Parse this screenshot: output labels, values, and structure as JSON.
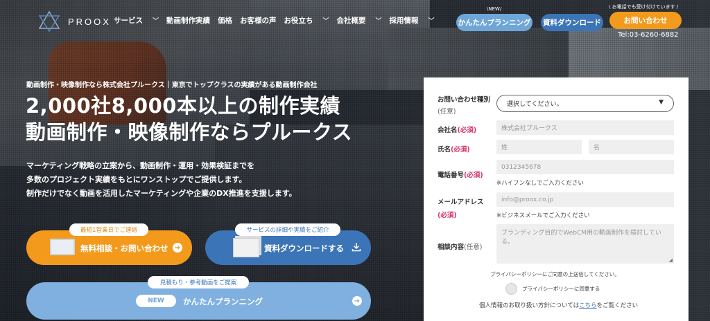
{
  "header": {
    "logo_text": "PROOX",
    "nav": [
      {
        "label": "サービス",
        "dropdown": true
      },
      {
        "label": "動画制作実績",
        "dropdown": false
      },
      {
        "label": "価格",
        "dropdown": false
      },
      {
        "label": "お客様の声",
        "dropdown": false
      },
      {
        "label": "お役立ち",
        "dropdown": true
      },
      {
        "label": "会社概要",
        "dropdown": true
      },
      {
        "label": "採用情報",
        "dropdown": true
      }
    ],
    "planning_note": "\\NEW/",
    "planning_button": "かんたんプランニング",
    "download_button": "資料ダウンロード",
    "contact_note": "\\ お電話でも受け付けています /",
    "contact_button": "お問い合わせ",
    "tel": "Tel:03-6260-6882"
  },
  "hero": {
    "subtitle": "動画制作・映像制作なら株式会社プルークス｜東京でトップクラスの実績がある動画制作会社",
    "title_line1": "2,000社8,000本以上の制作実績",
    "title_line2": "動画制作・映像制作ならプルークス",
    "desc_line1": "マーケティング戦略の立案から、動画制作・運用・効果検証までを",
    "desc_line2": "多数のプロジェクト実績をもとにワンストップでご提供します。",
    "desc_line3": "制作だけでなく動画を活用したマーケティングや企業のDX推進を支援します。"
  },
  "cta": {
    "free_tag": "最短1営業日でご連絡",
    "free_label": "無料相談・お問い合わせ",
    "dl_tag": "サービスの詳細や実績をご紹介",
    "dl_label": "資料ダウンロードする",
    "plan_tag": "見積もり・参考動画をご提案",
    "plan_new": "NEW",
    "plan_label": "かんたんプランニング"
  },
  "form": {
    "type_label": "お問い合わせ種別",
    "type_optional": "(任意)",
    "type_select": "選択してください。",
    "company_label": "会社名",
    "required": "(必須)",
    "company_placeholder": "株式会社プルークス",
    "name_label": "氏名",
    "last_name_placeholder": "姓",
    "first_name_placeholder": "名",
    "phone_label": "電話番号",
    "phone_placeholder": "0312345678",
    "phone_hint": "※ハイフンなしでご入力ください",
    "email_label": "メールアドレス",
    "email_placeholder": "info@proox.co.jp",
    "email_hint": "※ビジネスメールでご入力ください",
    "content_label": "相談内容",
    "content_optional": "(任意)",
    "content_placeholder": "ブランディング目的でWebCM用の動画制作を検討している。",
    "policy_note": "プライバシーポリシーにご同意の上送信してください。",
    "agree_label": "プライバシーポリシーに同意する",
    "privacy_prefix": "個人情報のお取り扱い方針については",
    "privacy_link": "こちら",
    "privacy_suffix": "をご覧ください"
  }
}
